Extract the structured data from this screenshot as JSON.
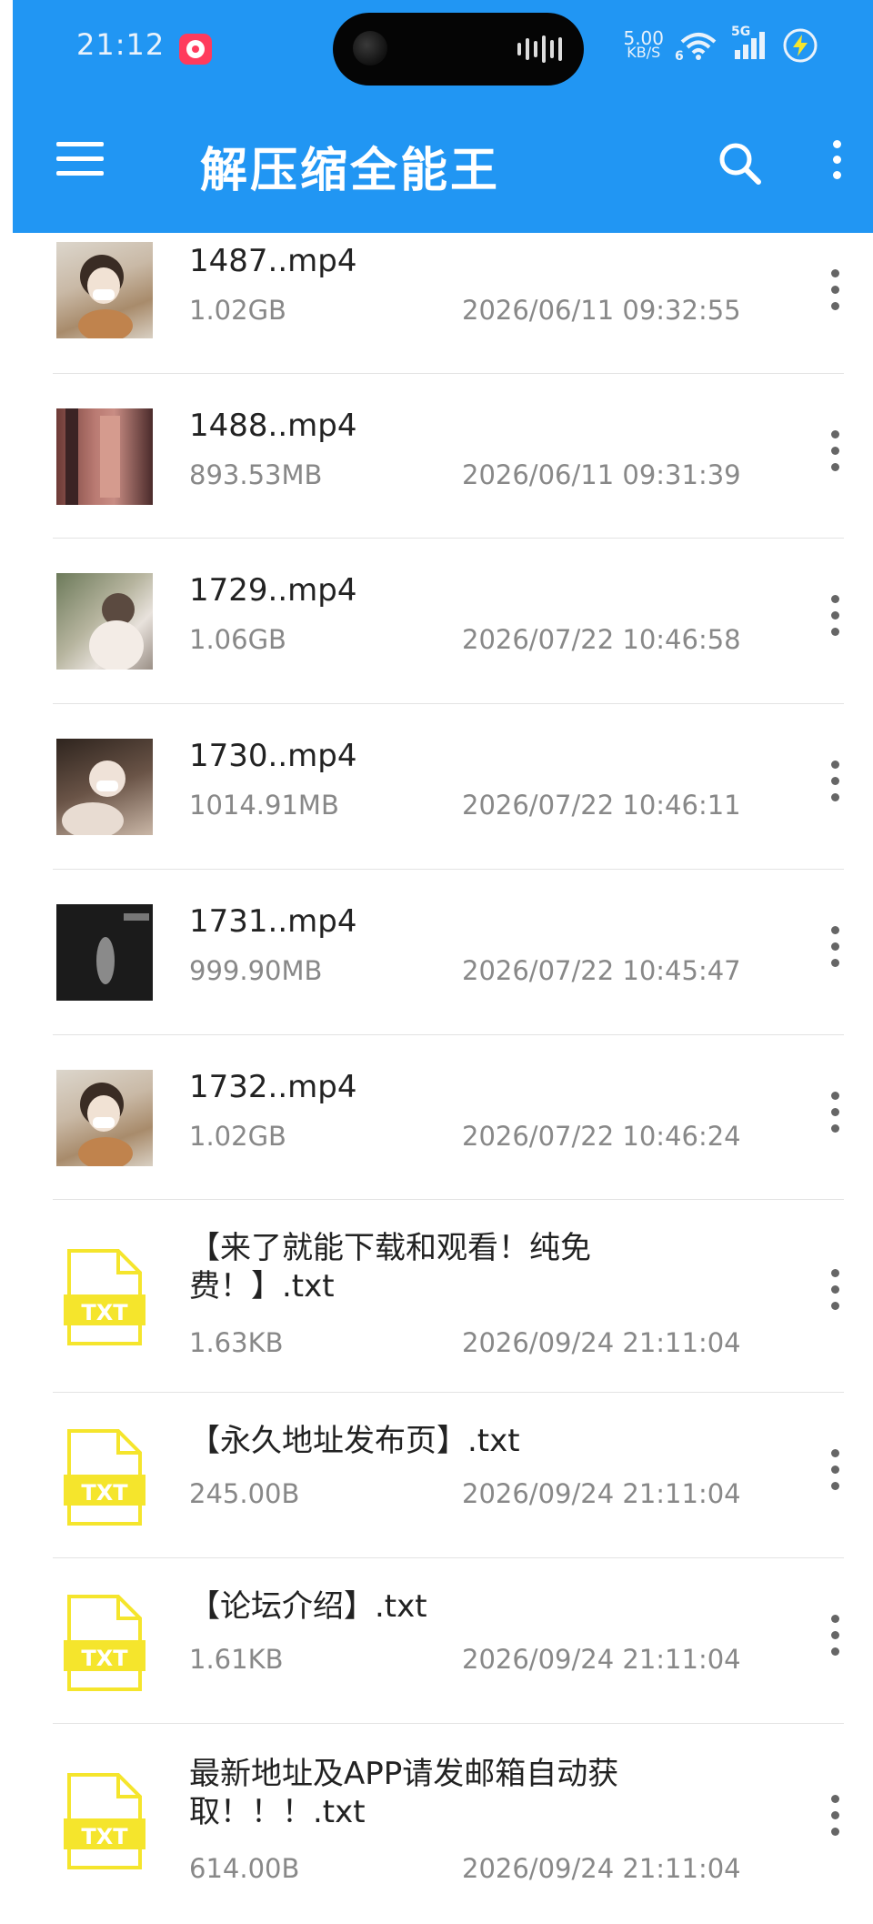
{
  "status_bar": {
    "time": "21:12",
    "net_speed_value": "5.00",
    "net_speed_unit": "KB/S",
    "wifi_badge": "6",
    "signal_label": "5G"
  },
  "appbar": {
    "title": "解压缩全能王"
  },
  "files": [
    {
      "name": "1487..mp4",
      "size": "1.02GB",
      "date": "2026/06/11 09:32:55",
      "type": "video"
    },
    {
      "name": "1488..mp4",
      "size": "893.53MB",
      "date": "2026/06/11 09:31:39",
      "type": "video"
    },
    {
      "name": "1729..mp4",
      "size": "1.06GB",
      "date": "2026/07/22 10:46:58",
      "type": "video"
    },
    {
      "name": "1730..mp4",
      "size": "1014.91MB",
      "date": "2026/07/22 10:46:11",
      "type": "video"
    },
    {
      "name": "1731..mp4",
      "size": "999.90MB",
      "date": "2026/07/22 10:45:47",
      "type": "video"
    },
    {
      "name": "1732..mp4",
      "size": "1.02GB",
      "date": "2026/07/22 10:46:24",
      "type": "video"
    },
    {
      "name": "【来了就能下载和观看！纯免费！】.txt",
      "size": "1.63KB",
      "date": "2026/09/24 21:11:04",
      "type": "txt"
    },
    {
      "name": "【永久地址发布页】.txt",
      "size": "245.00B",
      "date": "2026/09/24 21:11:04",
      "type": "txt"
    },
    {
      "name": "【论坛介绍】.txt",
      "size": "1.61KB",
      "date": "2026/09/24 21:11:04",
      "type": "txt"
    },
    {
      "name": "最新地址及APP请发邮箱自动获取！！！.txt",
      "size": "614.00B",
      "date": "2026/09/24 21:11:04",
      "type": "txt"
    }
  ],
  "txt_icon_label": "TXT",
  "colors": {
    "appbar": "#2196f3",
    "txt_icon": "#f5e52c"
  }
}
